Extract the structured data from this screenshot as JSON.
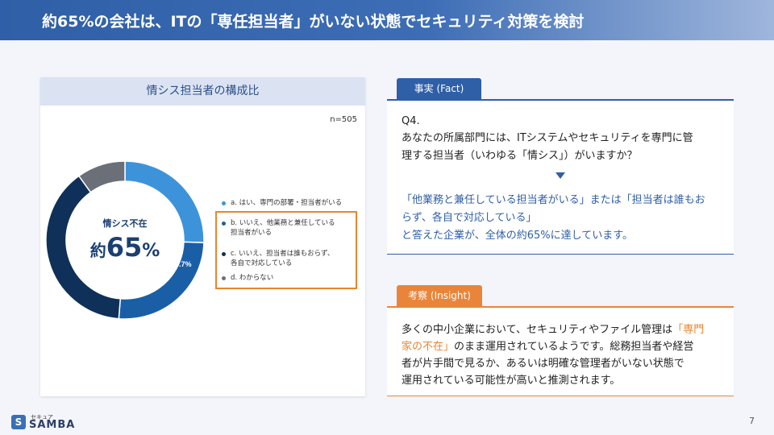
{
  "header": {
    "title": "約65%の会社は、ITの「専任担当者」がいない状態でセキュリティ対策を検討"
  },
  "chart": {
    "card_title": "情シス担当者の構成比",
    "sample": "n=505",
    "center_label": "情シス不在",
    "center_prefix": "約",
    "center_value": "65",
    "center_unit": "%",
    "legend": [
      {
        "label_lines": [
          "a. はい、専門の部署・担当者がいる"
        ]
      },
      {
        "label_lines": [
          "b. いいえ、他業務と兼任している",
          "担当者がいる"
        ]
      },
      {
        "label_lines": [
          "c. いいえ、担当者は誰もおらず、",
          "各自で対応している"
        ]
      },
      {
        "label_lines": [
          "d. わからない"
        ]
      }
    ],
    "highlight_color": "#e8852e"
  },
  "chart_data": {
    "type": "pie",
    "title": "情シス担当者の構成比",
    "categories": [
      "a. はい、専門の部署・担当者がいる",
      "b. いいえ、他業務と兼任している担当者がいる",
      "c. いいえ、担当者は誰もおらず、各自で対応している",
      "d. わからない"
    ],
    "values": [
      25.5,
      25.7,
      38.8,
      9.9
    ],
    "value_labels": [
      "25.5%",
      "25.7%",
      "38.8%",
      "9.9%"
    ],
    "colors": [
      "#3d93d9",
      "#1a5fa6",
      "#0f3058",
      "#6b6f78"
    ],
    "donut": true
  },
  "fact": {
    "tab_label": "事実 (Fact)",
    "q_label": "Q4.",
    "question_lines": [
      "あなたの所属部門には、ITシステムやセキュリティを専門に管",
      "理する担当者（いわゆる「情シス」）がいますか？"
    ],
    "answer_lines": [
      "「他業務と兼任している担当者がいる」または「担当者は誰もお",
      "らず、各自で対応している」",
      "と答えた企業が、全体の約65%に達しています。"
    ]
  },
  "insight": {
    "tab_label": "考察 (Insight)",
    "line1_pre": "多くの中小企業において、セキュリティやファイル管理は",
    "line1_hl": "「専門",
    "line2_hl": "家の不在」",
    "line2_post": "のまま運用されているようです。総務担当者や経営",
    "line3": "者が片手間で見るか、あるいは明確な管理者がいない状態で",
    "line4": "運用されている可能性が高いと推測されます。"
  },
  "footer": {
    "logo_mark": "S",
    "logo_small": "セキュア",
    "logo_text": "SAMBA",
    "page_number": "7"
  }
}
